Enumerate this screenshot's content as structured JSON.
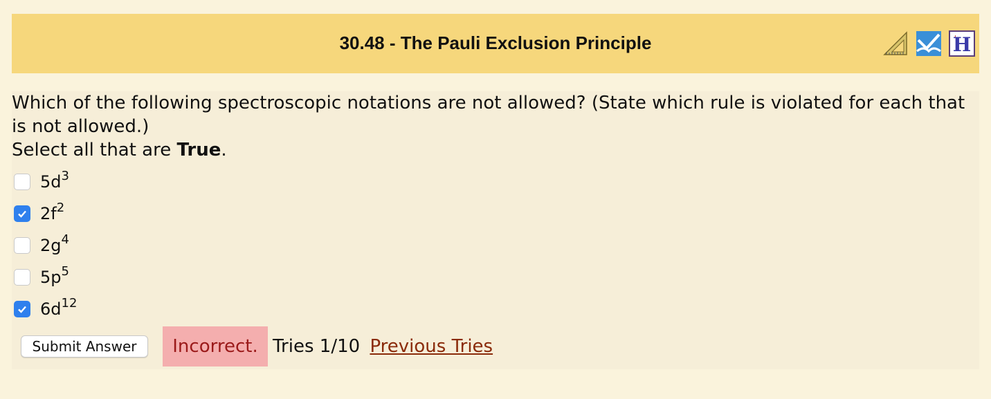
{
  "header": {
    "title": "30.48 - The Pauli Exclusion Principle",
    "icons": [
      "ruler-triangle-icon",
      "feedback-chart-icon",
      "help-h-icon"
    ]
  },
  "question": {
    "text": "Which of the following spectroscopic notations are not allowed? (State which rule is violated for each that is not allowed.)",
    "select_prefix": "Select all that are ",
    "select_bold": "True",
    "select_suffix": "."
  },
  "options": [
    {
      "base": "5d",
      "sup": "3",
      "checked": false
    },
    {
      "base": "2f",
      "sup": "2",
      "checked": true
    },
    {
      "base": "2g",
      "sup": "4",
      "checked": false
    },
    {
      "base": "5p",
      "sup": "5",
      "checked": false
    },
    {
      "base": "6d",
      "sup": "12",
      "checked": true
    }
  ],
  "actions": {
    "submit_label": "Submit Answer",
    "status": "Incorrect.",
    "tries": "Tries 1/10",
    "previous_tries": "Previous Tries"
  },
  "colors": {
    "header_bg": "#f6d77c",
    "incorrect_bg": "#f4aeae",
    "checkbox_accent": "#2f80ed"
  }
}
